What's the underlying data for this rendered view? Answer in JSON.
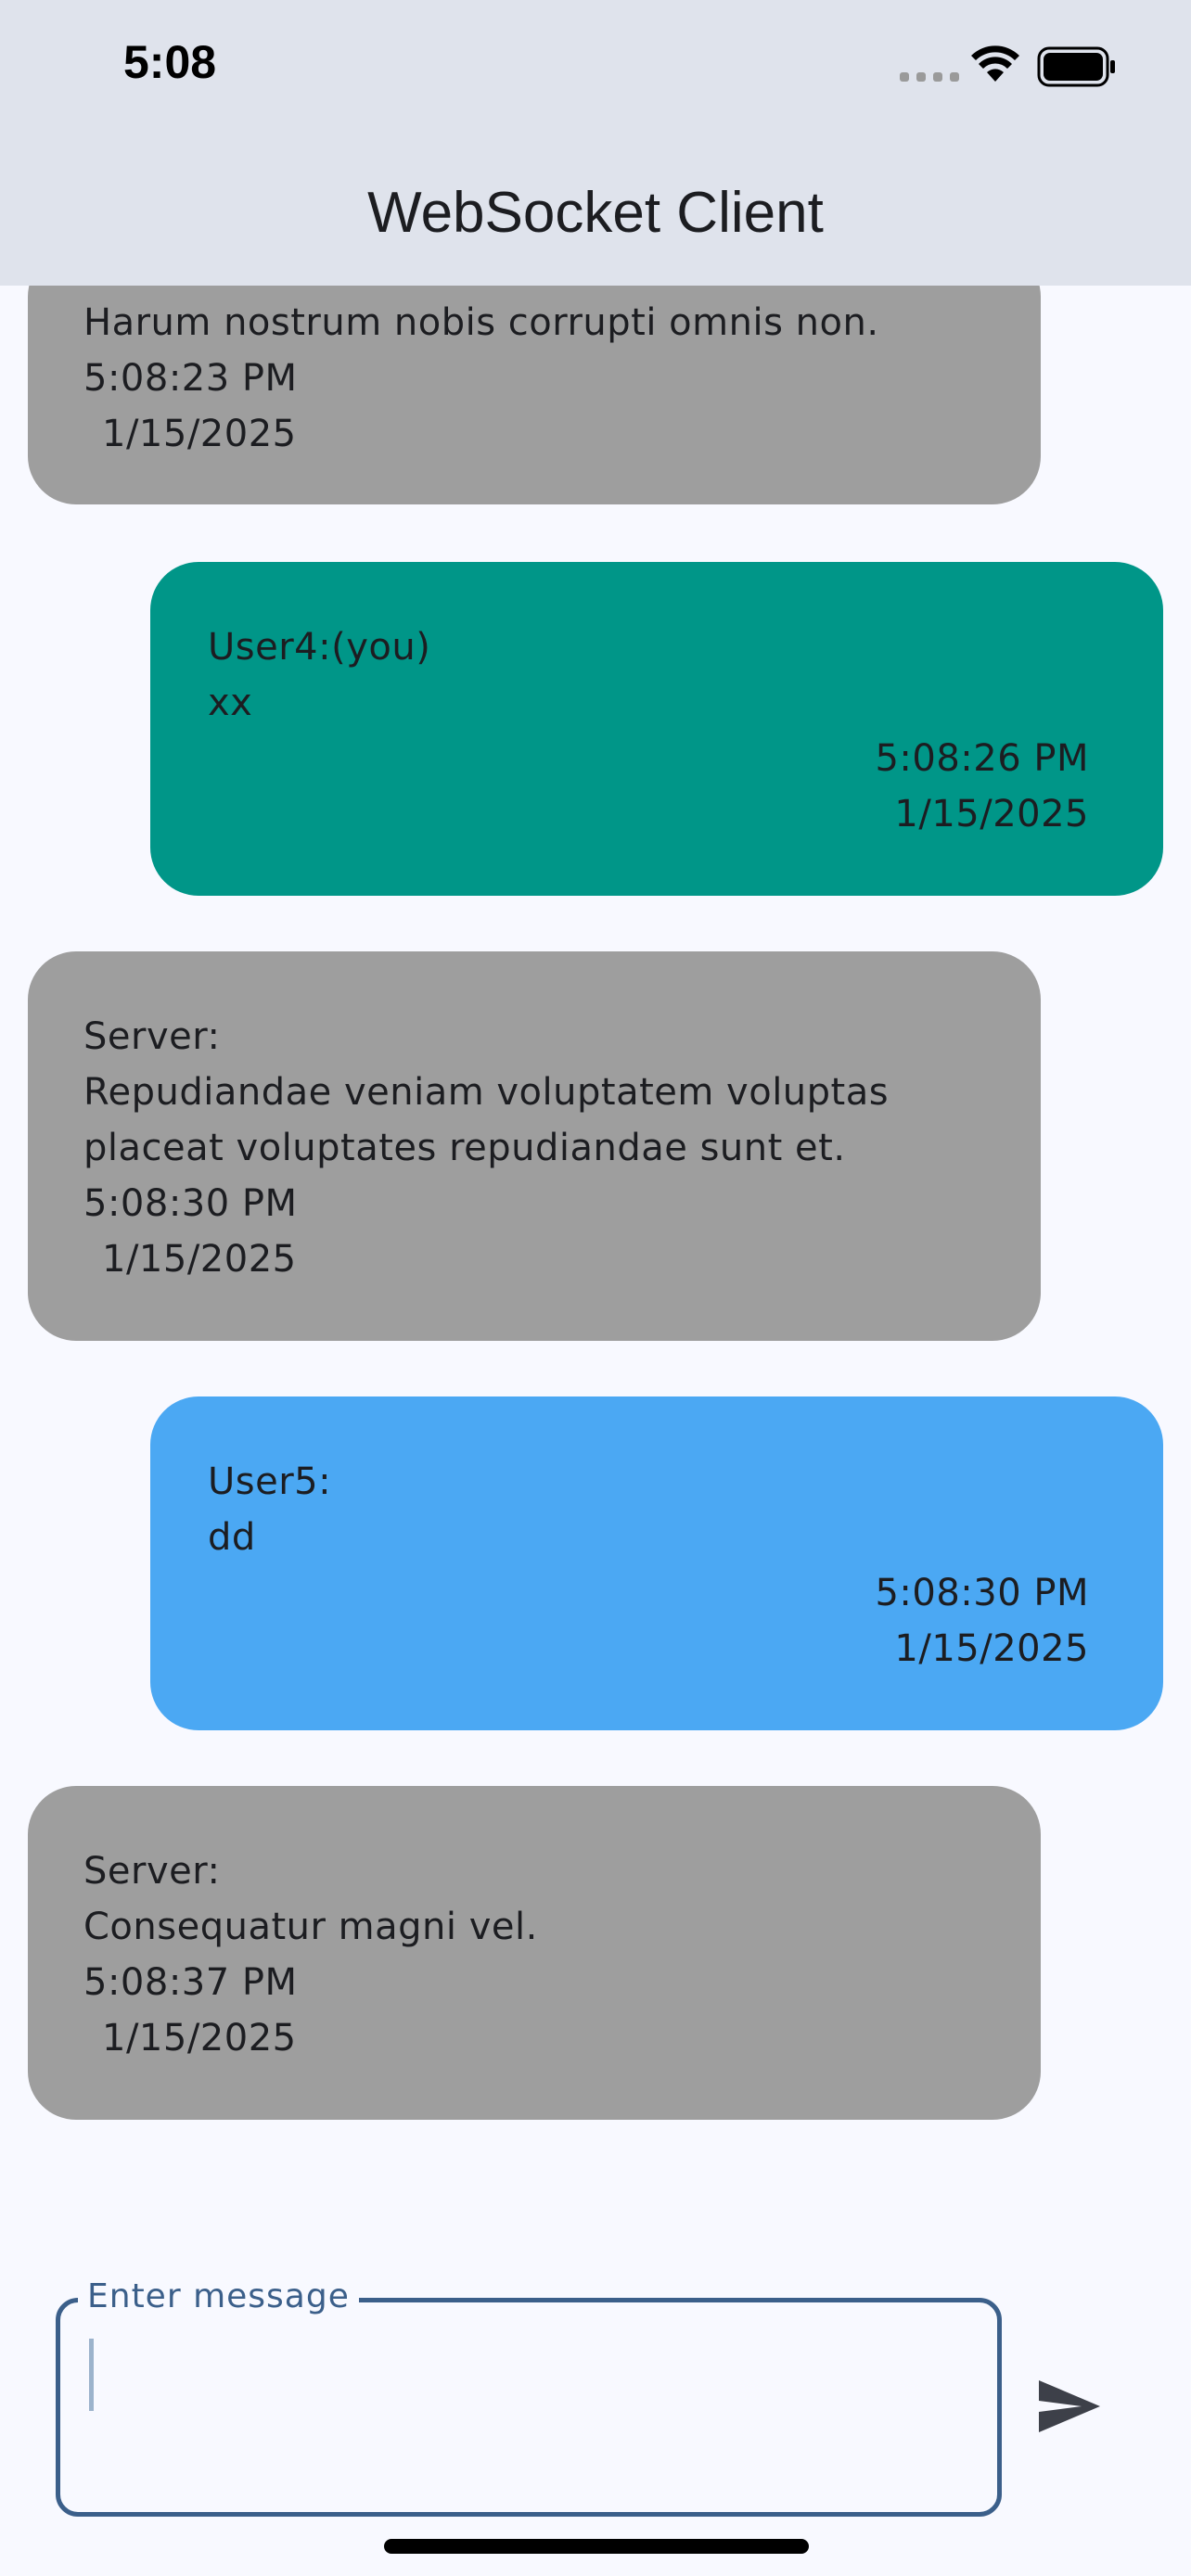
{
  "status_bar": {
    "time": "5:08"
  },
  "app": {
    "title": "WebSocket Client"
  },
  "messages": [
    {
      "sender": "",
      "text": "Harum nostrum nobis corrupti omnis non.",
      "time": "5:08:23 PM",
      "date": "1/15/2025",
      "kind": "server-partial"
    },
    {
      "sender": "User4:(you)",
      "text": "xx",
      "time": "5:08:26 PM",
      "date": "1/15/2025",
      "kind": "self",
      "color": "#009688"
    },
    {
      "sender": "Server:",
      "text": "Repudiandae veniam voluptatem voluptas placeat voluptates repudiandae sunt et.",
      "text_line1": "Repudiandae veniam voluptatem voluptas",
      "text_line2": "placeat voluptates repudiandae sunt et.",
      "time": "5:08:30 PM",
      "date": "1/15/2025",
      "kind": "server"
    },
    {
      "sender": "User5:",
      "text": "dd",
      "time": "5:08:30 PM",
      "date": "1/15/2025",
      "kind": "other-user",
      "color": "#4ba8f3"
    },
    {
      "sender": "Server:",
      "text": "Consequatur magni vel.",
      "time": "5:08:37 PM",
      "date": "1/15/2025",
      "kind": "server"
    }
  ],
  "composer": {
    "label": "Enter message",
    "value": ""
  },
  "colors": {
    "server_bubble": "#9e9e9e",
    "self_bubble": "#009688",
    "other_user_bubble": "#4ba8f3",
    "app_bar": "#dfe3ec",
    "accent": "#3b5f8a"
  }
}
